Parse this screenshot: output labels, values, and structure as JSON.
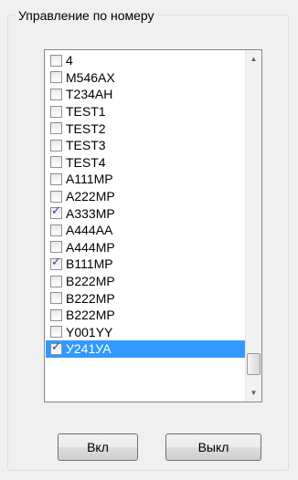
{
  "group": {
    "title": "Управление по номеру"
  },
  "list": {
    "items": [
      {
        "label": "4",
        "checked": false
      },
      {
        "label": "M546AX",
        "checked": false
      },
      {
        "label": "T234AH",
        "checked": false
      },
      {
        "label": "TEST1",
        "checked": false
      },
      {
        "label": "TEST2",
        "checked": false
      },
      {
        "label": "TEST3",
        "checked": false
      },
      {
        "label": "TEST4",
        "checked": false
      },
      {
        "label": "A111MP",
        "checked": false
      },
      {
        "label": "A222MP",
        "checked": false
      },
      {
        "label": "A333MP",
        "checked": true
      },
      {
        "label": "A444AA",
        "checked": false
      },
      {
        "label": "A444MP",
        "checked": false
      },
      {
        "label": "B111MP",
        "checked": true
      },
      {
        "label": "B222MP",
        "checked": false
      },
      {
        "label": "B222MP",
        "checked": false
      },
      {
        "label": "B222MP",
        "checked": false
      },
      {
        "label": "Y001YY",
        "checked": false
      },
      {
        "label": "У241УА",
        "checked": true,
        "selected": true
      }
    ]
  },
  "buttons": {
    "on_label": "Вкл",
    "off_label": "Выкл"
  },
  "colors": {
    "selection": "#3399ff"
  },
  "icons": {
    "scroll_up": "triangle-up-icon",
    "scroll_down": "triangle-down-icon"
  }
}
